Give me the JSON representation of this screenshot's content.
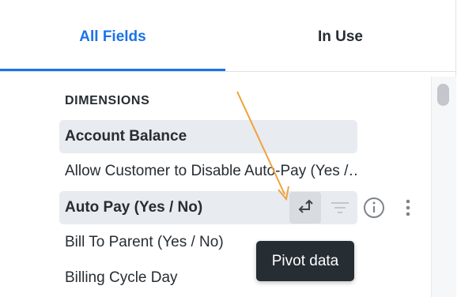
{
  "tabs": {
    "all_fields": "All Fields",
    "in_use": "In Use"
  },
  "section": {
    "heading": "DIMENSIONS"
  },
  "fields": [
    "Account Balance",
    "Allow Customer to Disable Auto-Pay (Yes / No)",
    "Auto Pay (Yes / No)",
    "Bill To Parent (Yes / No)",
    "Billing Cycle Day"
  ],
  "row_actions": {
    "pivot": "pivot-icon",
    "filter": "filter-icon",
    "info": "info-icon",
    "more": "more-vertical-icon"
  },
  "tooltip": {
    "text": "Pivot data"
  },
  "colors": {
    "accent": "#1a73e8",
    "tooltip_bg": "#262d33",
    "annotation_arrow": "#f0a23b"
  }
}
